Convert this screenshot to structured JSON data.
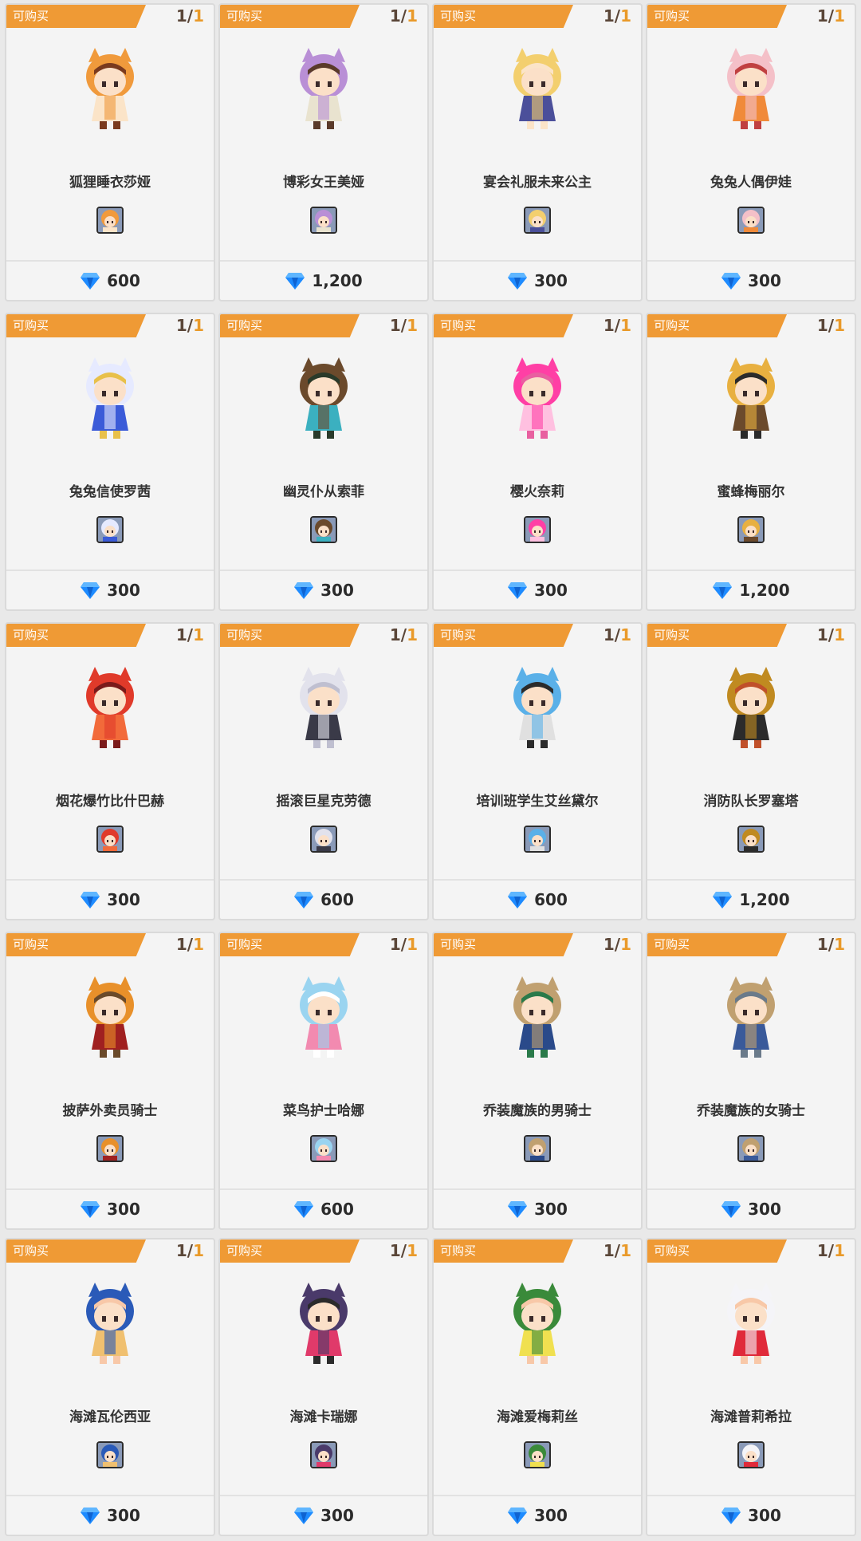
{
  "badge_label": "可购买",
  "limit": {
    "used": "1",
    "sep": "/",
    "total": "1"
  },
  "cards": [
    {
      "name": "狐狸睡衣莎娅",
      "price": "600",
      "palette": [
        "#f09a3c",
        "#fbe4c8",
        "#7a3a1e"
      ]
    },
    {
      "name": "博彩女王美娅",
      "price": "1,200",
      "palette": [
        "#b98fd6",
        "#e9e3cf",
        "#5a3a2a"
      ]
    },
    {
      "name": "宴会礼服未来公主",
      "price": "300",
      "palette": [
        "#f3cf6e",
        "#4b4f9a",
        "#fbe4c8"
      ]
    },
    {
      "name": "兔兔人偶伊娃",
      "price": "300",
      "palette": [
        "#f4c0c8",
        "#f08a3a",
        "#c04040"
      ]
    },
    {
      "name": "兔兔信使罗茜",
      "price": "300",
      "palette": [
        "#e6eaff",
        "#3b5bd8",
        "#e8c04a"
      ]
    },
    {
      "name": "幽灵仆从索菲",
      "price": "300",
      "palette": [
        "#6b4a2c",
        "#3bb0c0",
        "#2a3a2a"
      ]
    },
    {
      "name": "樱火奈莉",
      "price": "300",
      "palette": [
        "#ff3fa5",
        "#ffc0e0",
        "#e860a0"
      ]
    },
    {
      "name": "蜜蜂梅丽尔",
      "price": "1,200",
      "palette": [
        "#e8b040",
        "#6b4a2c",
        "#2b2b2b"
      ]
    },
    {
      "name": "烟花爆竹比什巴赫",
      "price": "300",
      "palette": [
        "#e03a2a",
        "#f26a3a",
        "#7a1a1a"
      ]
    },
    {
      "name": "摇滚巨星克劳德",
      "price": "600",
      "palette": [
        "#e2e2ec",
        "#3a3a48",
        "#bfbfd0"
      ]
    },
    {
      "name": "培训班学生艾丝黛尔",
      "price": "600",
      "palette": [
        "#5ab0e8",
        "#e0e0e0",
        "#2b2b2b"
      ]
    },
    {
      "name": "消防队长罗塞塔",
      "price": "1,200",
      "palette": [
        "#c08a20",
        "#2b2b2b",
        "#c0502a"
      ]
    },
    {
      "name": "披萨外卖员骑士",
      "price": "300",
      "palette": [
        "#e8902a",
        "#a02020",
        "#6a4a2a"
      ]
    },
    {
      "name": "菜鸟护士哈娜",
      "price": "600",
      "palette": [
        "#9ad4f0",
        "#f28ab0",
        "#ffffff"
      ]
    },
    {
      "name": "乔装魔族的男骑士",
      "price": "300",
      "palette": [
        "#c0a070",
        "#2a4a8a",
        "#2a7a4a"
      ]
    },
    {
      "name": "乔装魔族的女骑士",
      "price": "300",
      "palette": [
        "#c0a070",
        "#3a5a9a",
        "#6a7a8a"
      ]
    },
    {
      "name": "海滩瓦伦西亚",
      "price": "300",
      "palette": [
        "#2a5ab8",
        "#f0c070",
        "#f8c8a8"
      ]
    },
    {
      "name": "海滩卡瑞娜",
      "price": "300",
      "palette": [
        "#4a3a6a",
        "#e03a6a",
        "#2b2b2b"
      ]
    },
    {
      "name": "海滩爱梅莉丝",
      "price": "300",
      "palette": [
        "#3a8a3a",
        "#f0e050",
        "#f8c8a8"
      ]
    },
    {
      "name": "海滩普莉希拉",
      "price": "300",
      "palette": [
        "#f4f4f8",
        "#e02a3a",
        "#f8c8a8"
      ]
    }
  ],
  "colors": {
    "badge": "#ef9a35",
    "limit_total": "#e99a2a",
    "diamond": "#1e8bff"
  },
  "icons": {
    "currency": "diamond-icon"
  }
}
